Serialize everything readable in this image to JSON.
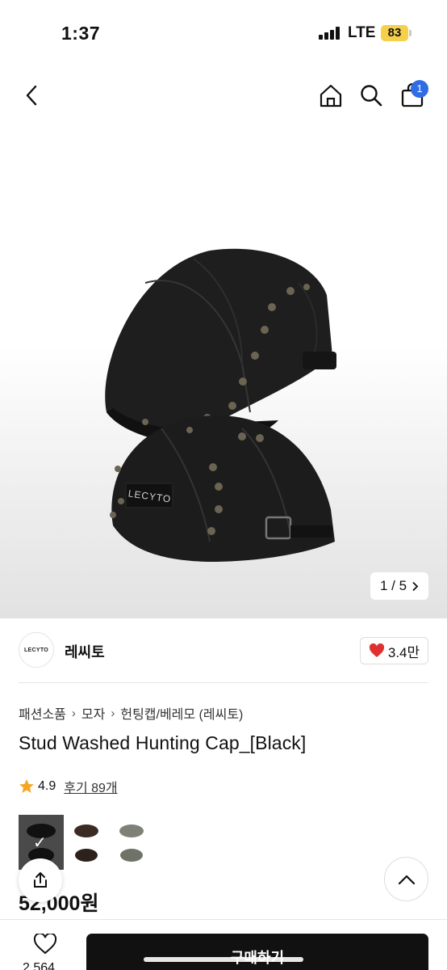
{
  "status": {
    "time": "1:37",
    "network": "LTE",
    "battery": "83"
  },
  "nav": {
    "cart_count": "1"
  },
  "gallery": {
    "counter": "1 / 5",
    "cap_label": "LECYTO"
  },
  "brand": {
    "logo_text": "LECYTO",
    "name": "레씨토",
    "likes": "3.4만"
  },
  "breadcrumb": [
    "패션소품",
    "모자",
    "헌팅캡/베레모 (레씨토)"
  ],
  "product": {
    "title": "Stud Washed Hunting Cap_[Black]",
    "rating": "4.9",
    "reviews": "후기 89개",
    "price": "52,000원"
  },
  "bottom": {
    "wish_count": "2,564",
    "buy_label": "구매하기"
  },
  "colors": {
    "accent": "#2f6ce5",
    "heart": "#e03131",
    "star": "#f5a623",
    "buy_bg": "#111111"
  }
}
